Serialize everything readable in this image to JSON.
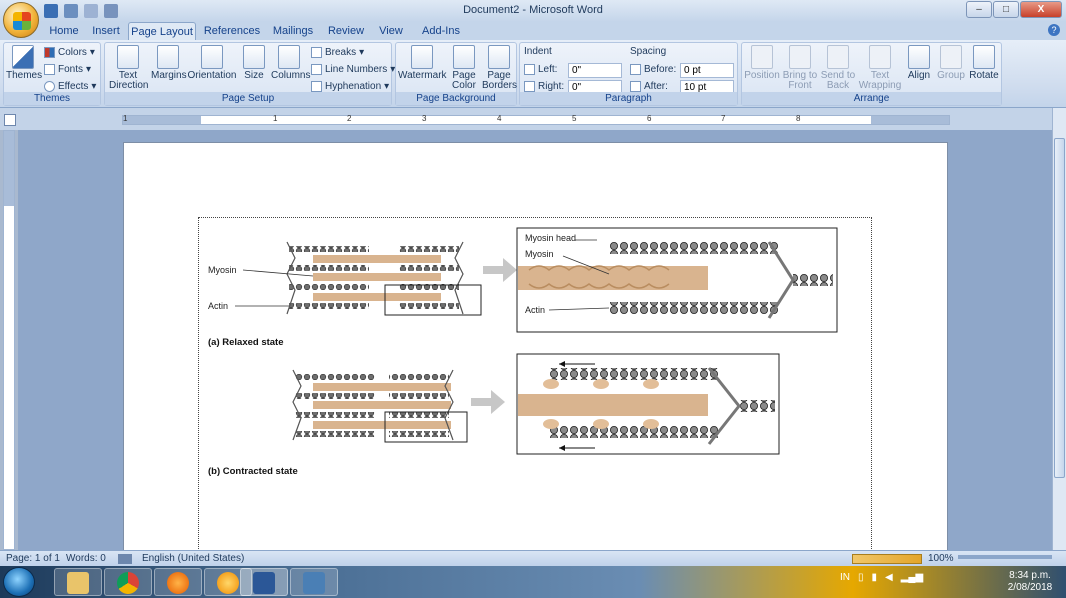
{
  "window": {
    "title": "Document2 - Microsoft Word",
    "minimize": "–",
    "maximize": "□",
    "close": "X"
  },
  "tabs": [
    "Home",
    "Insert",
    "Page Layout",
    "References",
    "Mailings",
    "Review",
    "View",
    "Add-Ins"
  ],
  "active_tab": "Page Layout",
  "ribbon": {
    "themes": {
      "label": "Themes",
      "themes_btn": "Themes",
      "colors": "Colors",
      "fonts": "Fonts",
      "effects": "Effects"
    },
    "page_setup": {
      "label": "Page Setup",
      "text_direction": "Text Direction",
      "margins": "Margins",
      "orientation": "Orientation",
      "size": "Size",
      "columns": "Columns",
      "breaks": "Breaks",
      "line_numbers": "Line Numbers",
      "hyphenation": "Hyphenation"
    },
    "page_background": {
      "label": "Page Background",
      "watermark": "Watermark",
      "page_color": "Page Color",
      "page_borders": "Page Borders"
    },
    "paragraph": {
      "label": "Paragraph",
      "indent": "Indent",
      "spacing": "Spacing",
      "left_label": "Left:",
      "left_value": "0\"",
      "right_label": "Right:",
      "right_value": "0\"",
      "before_label": "Before:",
      "before_value": "0 pt",
      "after_label": "After:",
      "after_value": "10 pt"
    },
    "arrange": {
      "label": "Arrange",
      "position": "Position",
      "bring_to_front": "Bring to Front",
      "send_to_back": "Send to Back",
      "text_wrapping": "Text Wrapping",
      "align": "Align",
      "group": "Group",
      "rotate": "Rotate"
    }
  },
  "ruler_numbers": [
    "1",
    "1",
    "2",
    "3",
    "4",
    "5",
    "6",
    "7",
    "8"
  ],
  "figure": {
    "myosin": "Myosin",
    "actin": "Actin",
    "myosin_head": "Myosin head",
    "caption_a": "(a) Relaxed state",
    "caption_b": "(b) Contracted state"
  },
  "status": {
    "page": "Page: 1 of 1",
    "words": "Words: 0",
    "language": "English (United States)",
    "zoom": "100%"
  },
  "taskbar": {
    "lang": "IN",
    "time": "8:34 p.m.",
    "date": "2/08/2018"
  },
  "colors": {
    "accent": "#15428b",
    "ribbon": "#dfe9f5",
    "myosin": "#d9b48f",
    "actin": "#555555"
  }
}
